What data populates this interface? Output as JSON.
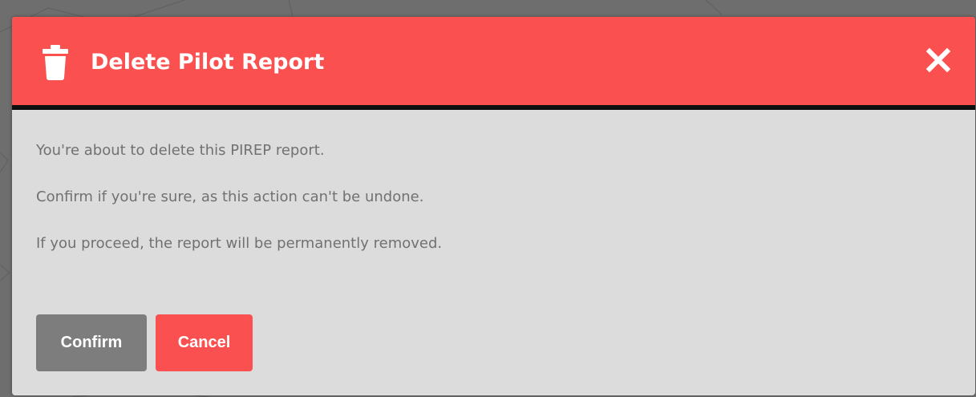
{
  "dialog": {
    "title": "Delete Pilot Report",
    "icon": "trash-icon",
    "close_icon": "close-icon",
    "header_color": "#fa5150",
    "body_lines": [
      "You're about to delete this PIREP report.",
      "Confirm if you're sure, as this action can't be undone.",
      "If you proceed, the report will be permanently removed."
    ],
    "buttons": {
      "confirm_label": "Confirm",
      "cancel_label": "Cancel"
    }
  }
}
